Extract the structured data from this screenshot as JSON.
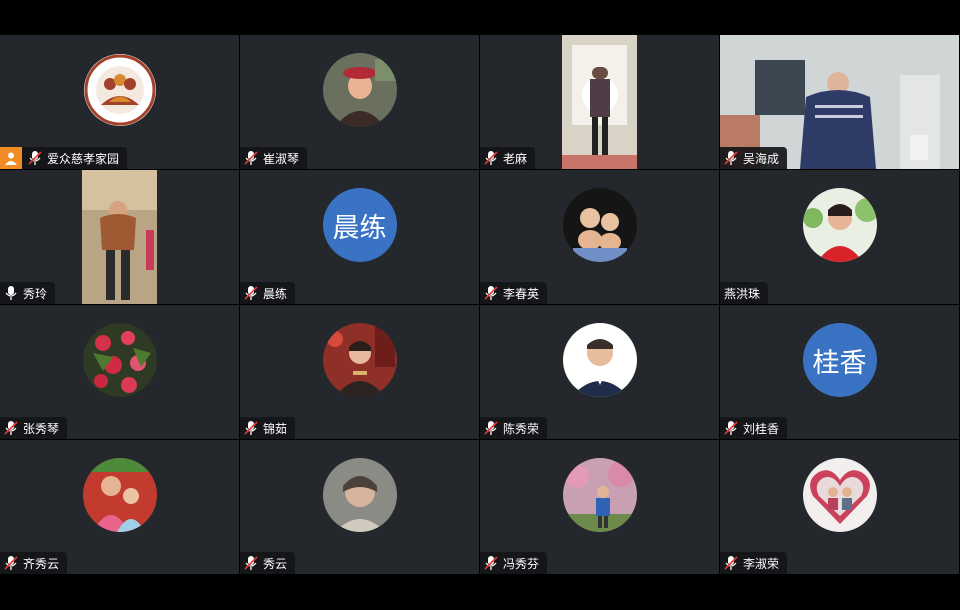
{
  "participants": [
    {
      "name": "爱众慈孝家园",
      "avatar": "logo",
      "mic": "muted",
      "host": true
    },
    {
      "name": "崔淑琴",
      "avatar": "photo-woman-hat",
      "mic": "muted"
    },
    {
      "name": "老麻",
      "avatar": "video-man-window",
      "mic": "muted"
    },
    {
      "name": "吴海成",
      "avatar": "video-man-room",
      "mic": "muted"
    },
    {
      "name": "秀玲",
      "avatar": "video-woman-hall",
      "mic": "on"
    },
    {
      "name": "晨练",
      "avatar": "text",
      "avatar_text": "晨练",
      "mic": "muted"
    },
    {
      "name": "李春英",
      "avatar": "photo-two-babies",
      "mic": "muted"
    },
    {
      "name": "燕洪珠",
      "avatar": "photo-woman-red",
      "mic": "none"
    },
    {
      "name": "张秀琴",
      "avatar": "photo-red-flowers",
      "mic": "muted"
    },
    {
      "name": "锦茹",
      "avatar": "photo-woman-red-bg",
      "mic": "muted"
    },
    {
      "name": "陈秀荣",
      "avatar": "photo-man-suit",
      "mic": "muted"
    },
    {
      "name": "刘桂香",
      "avatar": "text",
      "avatar_text": "桂香",
      "mic": "muted"
    },
    {
      "name": "齐秀云",
      "avatar": "photo-family",
      "mic": "muted"
    },
    {
      "name": "秀云",
      "avatar": "photo-woman-gray",
      "mic": "muted"
    },
    {
      "name": "冯秀芬",
      "avatar": "photo-woman-trees",
      "mic": "muted"
    },
    {
      "name": "李淑荣",
      "avatar": "photo-heart-frame",
      "mic": "muted"
    }
  ],
  "logo_text": {
    "top": "我为 · 分享 · 慈孝",
    "bottom": "爱众慈孝家园"
  },
  "colors": {
    "tile": "#24272b",
    "text_avatar": "#3a73c4",
    "host_badge": "#f08c23"
  }
}
